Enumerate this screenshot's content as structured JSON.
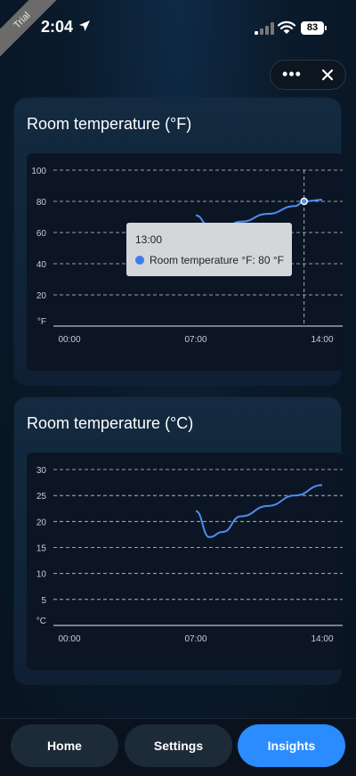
{
  "badge": "Trial",
  "status": {
    "time": "2:04",
    "battery": "83"
  },
  "menu": {
    "more_label": "•••"
  },
  "charts": [
    {
      "title": "Room temperature (°F)",
      "unit_label": "°F",
      "y_ticks": [
        "100",
        "80",
        "60",
        "40",
        "20"
      ],
      "x_ticks": [
        "00:00",
        "07:00",
        "14:00"
      ],
      "tooltip": {
        "time": "13:00",
        "text": "Room temperature °F: 80 °F"
      }
    },
    {
      "title": "Room temperature (°C)",
      "unit_label": "°C",
      "y_ticks": [
        "30",
        "25",
        "20",
        "15",
        "10",
        "5"
      ],
      "x_ticks": [
        "00:00",
        "07:00",
        "14:00"
      ]
    }
  ],
  "chart_data": [
    {
      "type": "line",
      "title": "Room temperature (°F)",
      "ylabel": "°F",
      "ylim": [
        0,
        100
      ],
      "x_tick_labels": [
        "00:00",
        "07:00",
        "14:00"
      ],
      "series": [
        {
          "name": "Room temperature °F",
          "color": "#4f8cf0",
          "x": [
            "07:00",
            "07:45",
            "08:30",
            "09:30",
            "11:00",
            "12:30",
            "13:00",
            "14:00"
          ],
          "y": [
            71,
            64,
            63,
            67,
            72,
            77,
            80,
            81
          ]
        }
      ]
    },
    {
      "type": "line",
      "title": "Room temperature (°C)",
      "ylabel": "°C",
      "ylim": [
        0,
        30
      ],
      "x_tick_labels": [
        "00:00",
        "07:00",
        "14:00"
      ],
      "series": [
        {
          "name": "Room temperature °C",
          "color": "#4f8cf0",
          "x": [
            "07:00",
            "07:45",
            "08:30",
            "09:30",
            "11:00",
            "12:30",
            "14:00"
          ],
          "y": [
            22,
            17,
            18,
            21,
            23,
            25,
            27
          ]
        }
      ]
    }
  ],
  "tabs": [
    {
      "label": "Home",
      "active": false
    },
    {
      "label": "Settings",
      "active": false
    },
    {
      "label": "Insights",
      "active": true
    }
  ]
}
